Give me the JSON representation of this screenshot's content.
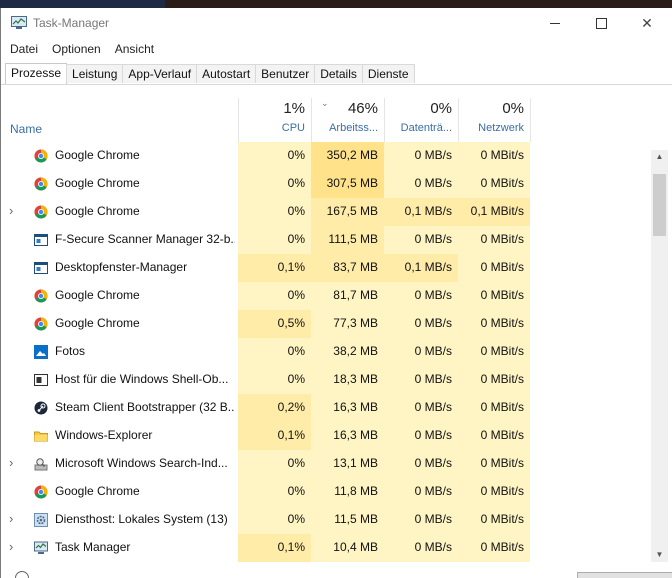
{
  "window": {
    "title": "Task-Manager"
  },
  "menu": [
    "Datei",
    "Optionen",
    "Ansicht"
  ],
  "tabs": [
    "Prozesse",
    "Leistung",
    "App-Verlauf",
    "Autostart",
    "Benutzer",
    "Details",
    "Dienste"
  ],
  "active_tab": 0,
  "columns": {
    "name": "Name",
    "cpu": {
      "percent": "1%",
      "label": "CPU"
    },
    "mem": {
      "percent": "46%",
      "label": "Arbeitss..."
    },
    "disk": {
      "percent": "0%",
      "label": "Datenträ..."
    },
    "net": {
      "percent": "0%",
      "label": "Netzwerk"
    }
  },
  "processes": [
    {
      "name": "Google Chrome",
      "icon": "chrome-icon",
      "expandable": false,
      "cpu": "0%",
      "mem": "350,2 MB",
      "disk": "0 MB/s",
      "net": "0 MBit/s",
      "heat": {
        "cpu": 0,
        "mem": 2,
        "disk": 0,
        "net": 0
      }
    },
    {
      "name": "Google Chrome",
      "icon": "chrome-icon",
      "expandable": false,
      "cpu": "0%",
      "mem": "307,5 MB",
      "disk": "0 MB/s",
      "net": "0 MBit/s",
      "heat": {
        "cpu": 0,
        "mem": 2,
        "disk": 0,
        "net": 0
      }
    },
    {
      "name": "Google Chrome",
      "icon": "chrome-icon",
      "expandable": true,
      "cpu": "0%",
      "mem": "167,5 MB",
      "disk": "0,1 MB/s",
      "net": "0,1 MBit/s",
      "heat": {
        "cpu": 0,
        "mem": 1,
        "disk": 1,
        "net": 1
      }
    },
    {
      "name": "F-Secure Scanner Manager 32-b...",
      "icon": "app-window-icon",
      "expandable": false,
      "cpu": "0%",
      "mem": "111,5 MB",
      "disk": "0 MB/s",
      "net": "0 MBit/s",
      "heat": {
        "cpu": 0,
        "mem": 1,
        "disk": 0,
        "net": 0
      }
    },
    {
      "name": "Desktopfenster-Manager",
      "icon": "app-window-icon",
      "expandable": false,
      "cpu": "0,1%",
      "mem": "83,7 MB",
      "disk": "0,1 MB/s",
      "net": "0 MBit/s",
      "heat": {
        "cpu": 1,
        "mem": 1,
        "disk": 1,
        "net": 0
      }
    },
    {
      "name": "Google Chrome",
      "icon": "chrome-icon",
      "expandable": false,
      "cpu": "0%",
      "mem": "81,7 MB",
      "disk": "0 MB/s",
      "net": "0 MBit/s",
      "heat": {
        "cpu": 0,
        "mem": 0,
        "disk": 0,
        "net": 0
      }
    },
    {
      "name": "Google Chrome",
      "icon": "chrome-icon",
      "expandable": false,
      "cpu": "0,5%",
      "mem": "77,3 MB",
      "disk": "0 MB/s",
      "net": "0 MBit/s",
      "heat": {
        "cpu": 1,
        "mem": 0,
        "disk": 0,
        "net": 0
      }
    },
    {
      "name": "Fotos",
      "icon": "photos-icon",
      "expandable": false,
      "cpu": "0%",
      "mem": "38,2 MB",
      "disk": "0 MB/s",
      "net": "0 MBit/s",
      "heat": {
        "cpu": 0,
        "mem": 0,
        "disk": 0,
        "net": 0
      }
    },
    {
      "name": "Host für die Windows Shell-Ob...",
      "icon": "shell-host-icon",
      "expandable": false,
      "cpu": "0%",
      "mem": "18,3 MB",
      "disk": "0 MB/s",
      "net": "0 MBit/s",
      "heat": {
        "cpu": 0,
        "mem": 0,
        "disk": 0,
        "net": 0
      }
    },
    {
      "name": "Steam Client Bootstrapper (32 B...",
      "icon": "steam-icon",
      "expandable": false,
      "cpu": "0,2%",
      "mem": "16,3 MB",
      "disk": "0 MB/s",
      "net": "0 MBit/s",
      "heat": {
        "cpu": 1,
        "mem": 0,
        "disk": 0,
        "net": 0
      }
    },
    {
      "name": "Windows-Explorer",
      "icon": "folder-icon",
      "expandable": false,
      "cpu": "0,1%",
      "mem": "16,3 MB",
      "disk": "0 MB/s",
      "net": "0 MBit/s",
      "heat": {
        "cpu": 1,
        "mem": 0,
        "disk": 0,
        "net": 0
      }
    },
    {
      "name": "Microsoft Windows Search-Ind...",
      "icon": "search-indexer-icon",
      "expandable": true,
      "cpu": "0%",
      "mem": "13,1 MB",
      "disk": "0 MB/s",
      "net": "0 MBit/s",
      "heat": {
        "cpu": 0,
        "mem": 0,
        "disk": 0,
        "net": 0
      }
    },
    {
      "name": "Google Chrome",
      "icon": "chrome-icon",
      "expandable": false,
      "cpu": "0%",
      "mem": "11,8 MB",
      "disk": "0 MB/s",
      "net": "0 MBit/s",
      "heat": {
        "cpu": 0,
        "mem": 0,
        "disk": 0,
        "net": 0
      }
    },
    {
      "name": "Diensthost: Lokales System (13)",
      "icon": "gear-icon",
      "expandable": true,
      "cpu": "0%",
      "mem": "11,5 MB",
      "disk": "0 MB/s",
      "net": "0 MBit/s",
      "heat": {
        "cpu": 0,
        "mem": 0,
        "disk": 0,
        "net": 0
      }
    },
    {
      "name": "Task Manager",
      "icon": "taskmanager-icon",
      "expandable": true,
      "cpu": "0,1%",
      "mem": "10,4 MB",
      "disk": "0 MB/s",
      "net": "0 MBit/s",
      "heat": {
        "cpu": 1,
        "mem": 0,
        "disk": 0,
        "net": 0
      }
    }
  ],
  "colors": {
    "heat0": "#fff4c4",
    "heat1": "#ffeca8",
    "heat2": "#ffe28a",
    "header_label": "#3a6ea5"
  }
}
